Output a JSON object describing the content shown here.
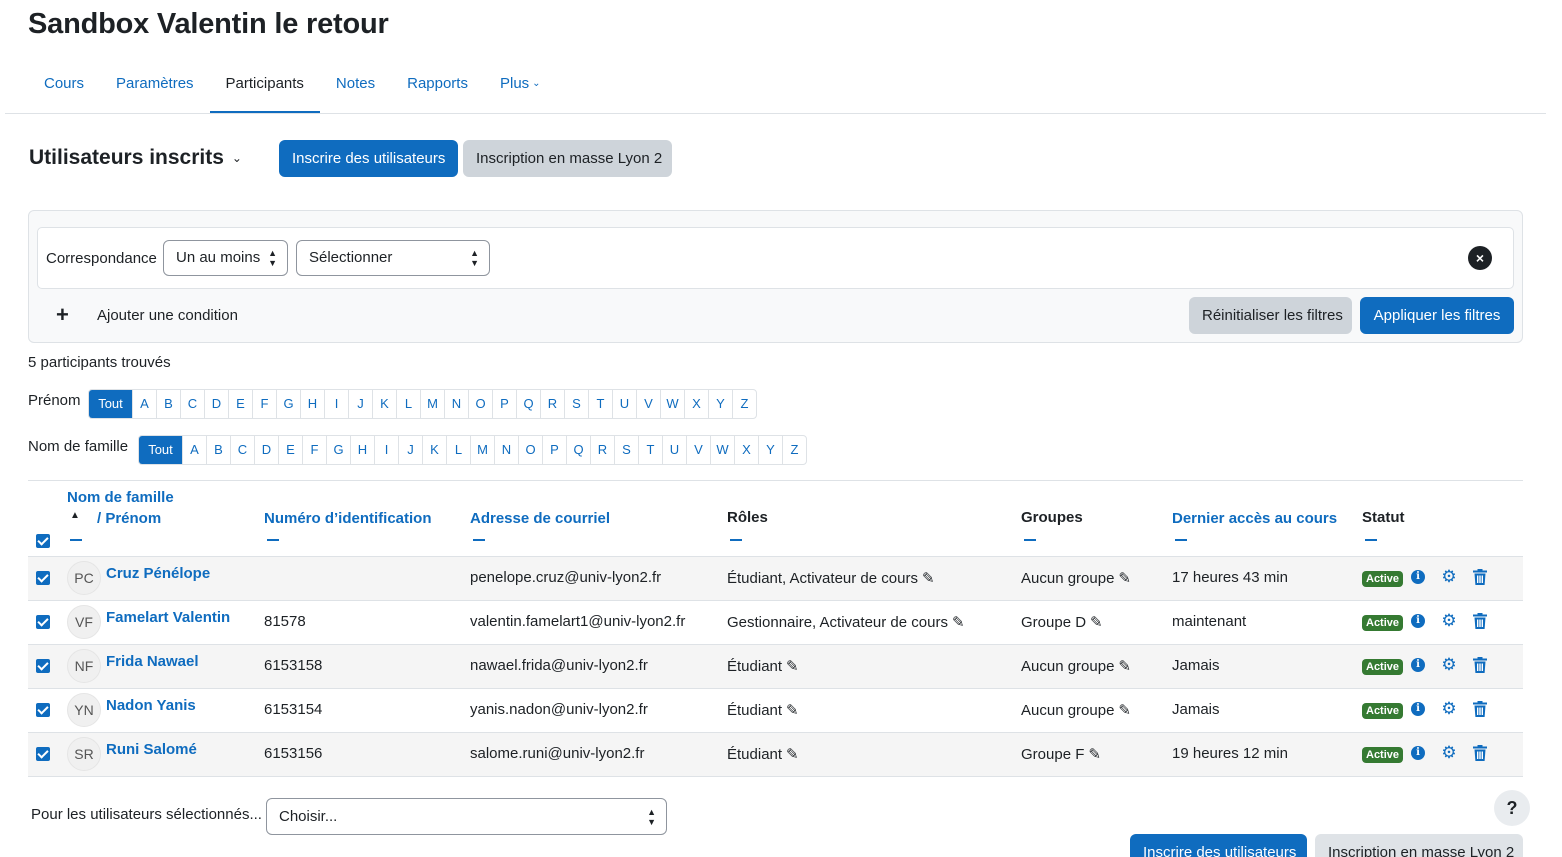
{
  "page": {
    "title": "Sandbox Valentin le retour"
  },
  "nav": {
    "tabs": [
      {
        "label": "Cours"
      },
      {
        "label": "Paramètres"
      },
      {
        "label": "Participants"
      },
      {
        "label": "Notes"
      },
      {
        "label": "Rapports"
      },
      {
        "label": "Plus"
      }
    ],
    "active": "Participants"
  },
  "heading": {
    "title": "Utilisateurs inscrits",
    "enrol_button": "Inscrire des utilisateurs",
    "bulk_button": "Inscription en masse Lyon 2"
  },
  "filter": {
    "match_label": "Correspondance",
    "match_value": "Un au moins",
    "type_value": "Sélectionner",
    "add_condition": "Ajouter une condition",
    "reset": "Réinitialiser les filtres",
    "apply": "Appliquer les filtres"
  },
  "found_text": "5 participants trouvés",
  "initials": {
    "firstname_label": "Prénom",
    "lastname_label": "Nom de famille",
    "all": "Tout",
    "letters": [
      "A",
      "B",
      "C",
      "D",
      "E",
      "F",
      "G",
      "H",
      "I",
      "J",
      "K",
      "L",
      "M",
      "N",
      "O",
      "P",
      "Q",
      "R",
      "S",
      "T",
      "U",
      "V",
      "W",
      "X",
      "Y",
      "Z"
    ]
  },
  "table": {
    "headers": {
      "lastname": "Nom de famille",
      "firstname": "/ Prénom",
      "idnumber": "Numéro d’identification",
      "email": "Adresse de courriel",
      "roles": "Rôles",
      "groups": "Groupes",
      "lastaccess": "Dernier accès au cours",
      "status": "Statut"
    },
    "rows": [
      {
        "initials": "PC",
        "name": "Cruz Pénélope",
        "idnumber": "",
        "email": "penelope.cruz@univ-lyon2.fr",
        "roles": "Étudiant, Activateur de cours",
        "groups": "Aucun groupe",
        "lastaccess": "17 heures 43 min",
        "status": "Active"
      },
      {
        "initials": "VF",
        "name": "Famelart Valentin",
        "idnumber": "81578",
        "email": "valentin.famelart1@univ-lyon2.fr",
        "roles": "Gestionnaire, Activateur de cours",
        "groups": "Groupe D",
        "lastaccess": "maintenant",
        "status": "Active"
      },
      {
        "initials": "NF",
        "name": "Frida Nawael",
        "idnumber": "6153158",
        "email": "nawael.frida@univ-lyon2.fr",
        "roles": "Étudiant",
        "groups": "Aucun groupe",
        "lastaccess": "Jamais",
        "status": "Active"
      },
      {
        "initials": "YN",
        "name": "Nadon Yanis",
        "idnumber": "6153154",
        "email": "yanis.nadon@univ-lyon2.fr",
        "roles": "Étudiant",
        "groups": "Aucun groupe",
        "lastaccess": "Jamais",
        "status": "Active"
      },
      {
        "initials": "SR",
        "name": "Runi Salomé",
        "idnumber": "6153156",
        "email": "salome.runi@univ-lyon2.fr",
        "roles": "Étudiant",
        "groups": "Groupe F",
        "lastaccess": "19 heures 12 min",
        "status": "Active"
      }
    ]
  },
  "bulk": {
    "label": "Pour les utilisateurs sélectionnés...",
    "select_value": "Choisir..."
  },
  "footer": {
    "enrol_button": "Inscrire des utilisateurs",
    "bulk_button": "Inscription en masse Lyon 2",
    "help": "?"
  }
}
